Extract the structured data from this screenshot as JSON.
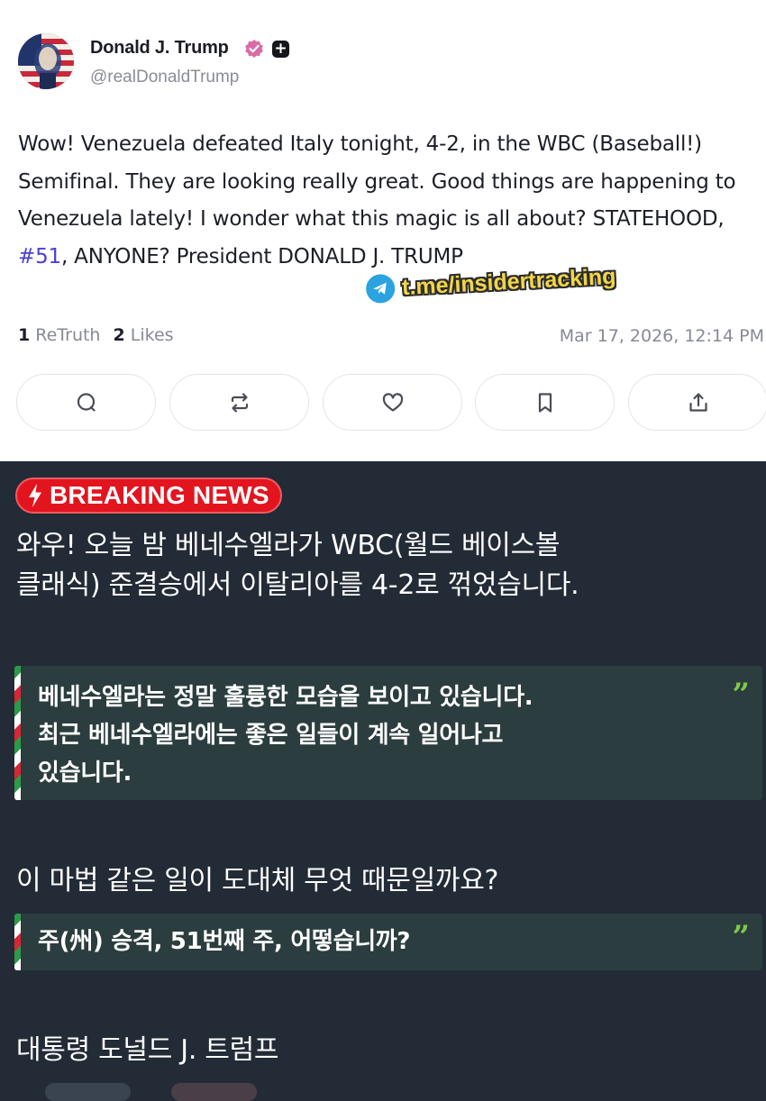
{
  "post": {
    "author_name": "Donald J. Trump",
    "handle": "@realDonaldTrump",
    "text_before_hashtag": "Wow! Venezuela defeated Italy tonight, 4-2, in the WBC (Baseball!) Semifinal. They are looking really great. Good things are happening to Venezuela lately! I wonder what this magic is all about? STATEHOOD, ",
    "hashtag": "#51",
    "text_after_hashtag": ", ANYONE? President DONALD J. TRUMP",
    "retruth_count": "1",
    "retruth_label": "ReTruth",
    "likes_count": "2",
    "likes_label": "Likes",
    "timestamp": "Mar 17, 2026, 12:14 PM",
    "actions": [
      "reply-icon",
      "retruth-icon",
      "like-icon",
      "bookmark-icon",
      "share-icon"
    ]
  },
  "watermark": {
    "text": "t.me/insidertracking",
    "icon": "telegram-icon"
  },
  "news": {
    "badge_label": "BREAKING NEWS",
    "lead_line_1": "와우! 오늘 밤 베네수엘라가 WBC(월드 베이스볼",
    "lead_line_2": "클래식) 준결승에서 이탈리아를 4-2로 꺾었습니다.",
    "quote_1_line_1": "베네수엘라는 정말 훌륭한 모습을 보이고 있습니다.",
    "quote_1_line_2": "최근 베네수엘라에는 좋은 일들이 계속 일어나고",
    "quote_1_line_3": "있습니다.",
    "question": "이 마법 같은 일이 도대체 무엇 때문일까요?",
    "quote_2": "주(州) 승격, 51번째 주, 어떻습니까?",
    "signoff": "대통령 도널드 J. 트럼프",
    "quote_mark": "”"
  },
  "colors": {
    "breaking_red": "#e2151f",
    "panel_bg": "#222b36",
    "quote_bg": "#2b3d3e",
    "quote_mark_green": "#7cc94a",
    "hashtag_purple": "#4b3fd4",
    "verified_pink": "#d96aa6",
    "watermark_yellow": "#f2d648",
    "telegram_blue": "#2aa3e0"
  }
}
